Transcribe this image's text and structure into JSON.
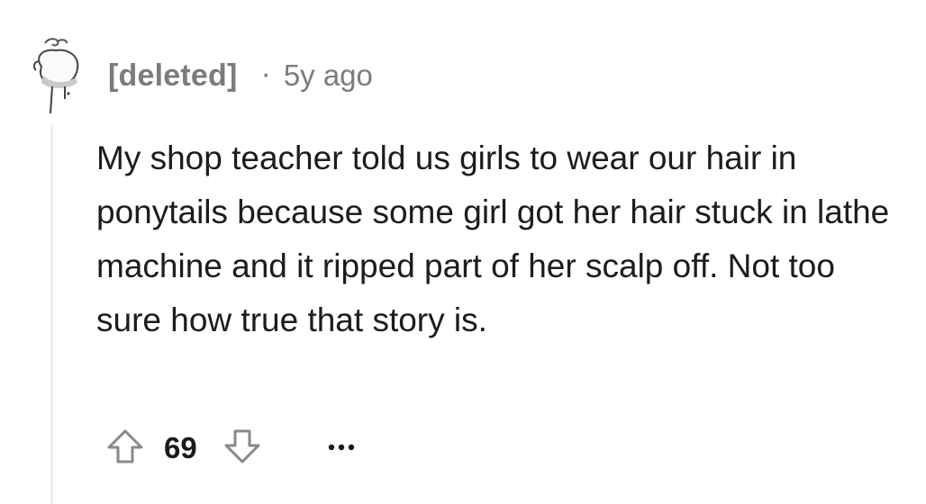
{
  "comment": {
    "author": "[deleted]",
    "separator": "·",
    "age": "5y ago",
    "body": "My shop teacher told us girls to wear our hair in ponytails because some girl got her hair stuck in lathe machine and it ripped part of her scalp off. Not too sure how true that story is.",
    "score": "69",
    "avatar_icon": "deleted-user-avatar-icon",
    "upvote_icon": "upvote-arrow-icon",
    "downvote_icon": "downvote-arrow-icon",
    "more_icon": "more-options-icon"
  },
  "colors": {
    "meta_text": "#7c7c7c",
    "body_text": "#1c1c1c",
    "thread_line": "#eceef0",
    "icon_stroke": "#878a8c"
  }
}
